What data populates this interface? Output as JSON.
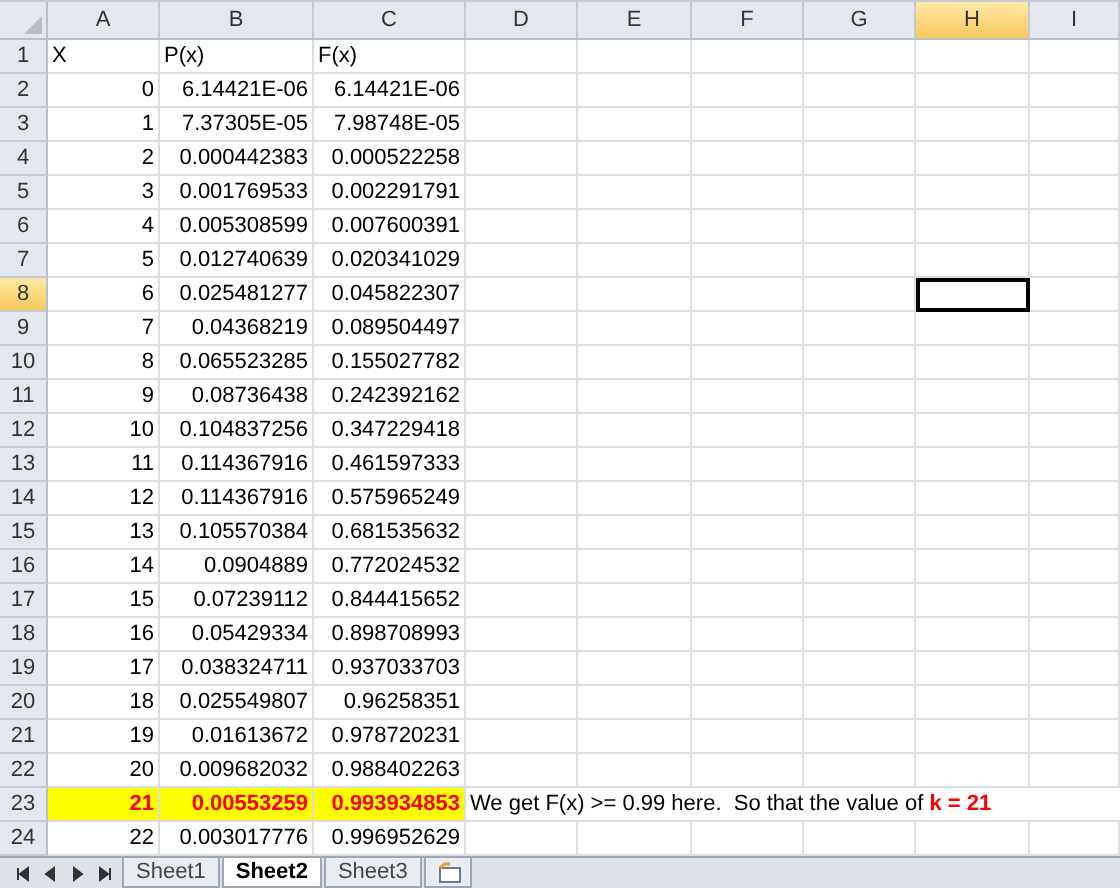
{
  "columns": [
    {
      "label": "A",
      "selected": false
    },
    {
      "label": "B",
      "selected": false
    },
    {
      "label": "C",
      "selected": false
    },
    {
      "label": "D",
      "selected": false
    },
    {
      "label": "E",
      "selected": false
    },
    {
      "label": "F",
      "selected": false
    },
    {
      "label": "G",
      "selected": false
    },
    {
      "label": "H",
      "selected": true
    },
    {
      "label": "I",
      "selected": false
    }
  ],
  "rows": [
    {
      "header": "1",
      "selected": false,
      "highlighted": false,
      "kind": "label",
      "cells": [
        "X",
        "P(x)",
        "F(x)"
      ]
    },
    {
      "header": "2",
      "selected": false,
      "highlighted": false,
      "kind": "number",
      "cells": [
        "0",
        "6.14421E-06",
        "6.14421E-06"
      ]
    },
    {
      "header": "3",
      "selected": false,
      "highlighted": false,
      "kind": "number",
      "cells": [
        "1",
        "7.37305E-05",
        "7.98748E-05"
      ]
    },
    {
      "header": "4",
      "selected": false,
      "highlighted": false,
      "kind": "number",
      "cells": [
        "2",
        "0.000442383",
        "0.000522258"
      ]
    },
    {
      "header": "5",
      "selected": false,
      "highlighted": false,
      "kind": "number",
      "cells": [
        "3",
        "0.001769533",
        "0.002291791"
      ]
    },
    {
      "header": "6",
      "selected": false,
      "highlighted": false,
      "kind": "number",
      "cells": [
        "4",
        "0.005308599",
        "0.007600391"
      ]
    },
    {
      "header": "7",
      "selected": false,
      "highlighted": false,
      "kind": "number",
      "cells": [
        "5",
        "0.012740639",
        "0.020341029"
      ]
    },
    {
      "header": "8",
      "selected": true,
      "highlighted": false,
      "kind": "number",
      "cells": [
        "6",
        "0.025481277",
        "0.045822307"
      ]
    },
    {
      "header": "9",
      "selected": false,
      "highlighted": false,
      "kind": "number",
      "cells": [
        "7",
        "0.04368219",
        "0.089504497"
      ]
    },
    {
      "header": "10",
      "selected": false,
      "highlighted": false,
      "kind": "number",
      "cells": [
        "8",
        "0.065523285",
        "0.155027782"
      ]
    },
    {
      "header": "11",
      "selected": false,
      "highlighted": false,
      "kind": "number",
      "cells": [
        "9",
        "0.08736438",
        "0.242392162"
      ]
    },
    {
      "header": "12",
      "selected": false,
      "highlighted": false,
      "kind": "number",
      "cells": [
        "10",
        "0.104837256",
        "0.347229418"
      ]
    },
    {
      "header": "13",
      "selected": false,
      "highlighted": false,
      "kind": "number",
      "cells": [
        "11",
        "0.114367916",
        "0.461597333"
      ]
    },
    {
      "header": "14",
      "selected": false,
      "highlighted": false,
      "kind": "number",
      "cells": [
        "12",
        "0.114367916",
        "0.575965249"
      ]
    },
    {
      "header": "15",
      "selected": false,
      "highlighted": false,
      "kind": "number",
      "cells": [
        "13",
        "0.105570384",
        "0.681535632"
      ]
    },
    {
      "header": "16",
      "selected": false,
      "highlighted": false,
      "kind": "number",
      "cells": [
        "14",
        "0.0904889",
        "0.772024532"
      ]
    },
    {
      "header": "17",
      "selected": false,
      "highlighted": false,
      "kind": "number",
      "cells": [
        "15",
        "0.07239112",
        "0.844415652"
      ]
    },
    {
      "header": "18",
      "selected": false,
      "highlighted": false,
      "kind": "number",
      "cells": [
        "16",
        "0.05429334",
        "0.898708993"
      ]
    },
    {
      "header": "19",
      "selected": false,
      "highlighted": false,
      "kind": "number",
      "cells": [
        "17",
        "0.038324711",
        "0.937033703"
      ]
    },
    {
      "header": "20",
      "selected": false,
      "highlighted": false,
      "kind": "number",
      "cells": [
        "18",
        "0.025549807",
        "0.96258351"
      ]
    },
    {
      "header": "21",
      "selected": false,
      "highlighted": false,
      "kind": "number",
      "cells": [
        "19",
        "0.01613672",
        "0.978720231"
      ]
    },
    {
      "header": "22",
      "selected": false,
      "highlighted": false,
      "kind": "number",
      "cells": [
        "20",
        "0.009682032",
        "0.988402263"
      ]
    },
    {
      "header": "23",
      "selected": false,
      "highlighted": true,
      "kind": "number",
      "cells": [
        "21",
        "0.00553259",
        "0.993934853"
      ],
      "note": "We get F(x) >= 0.99 here.  So that the value of **k = 21**"
    },
    {
      "header": "24",
      "selected": false,
      "highlighted": false,
      "kind": "number",
      "cells": [
        "22",
        "0.003017776",
        "0.996952629"
      ]
    }
  ],
  "sheet_tabs": [
    {
      "label": "Sheet1",
      "selected": false
    },
    {
      "label": "Sheet2",
      "selected": true
    },
    {
      "label": "Sheet3",
      "selected": false
    }
  ]
}
